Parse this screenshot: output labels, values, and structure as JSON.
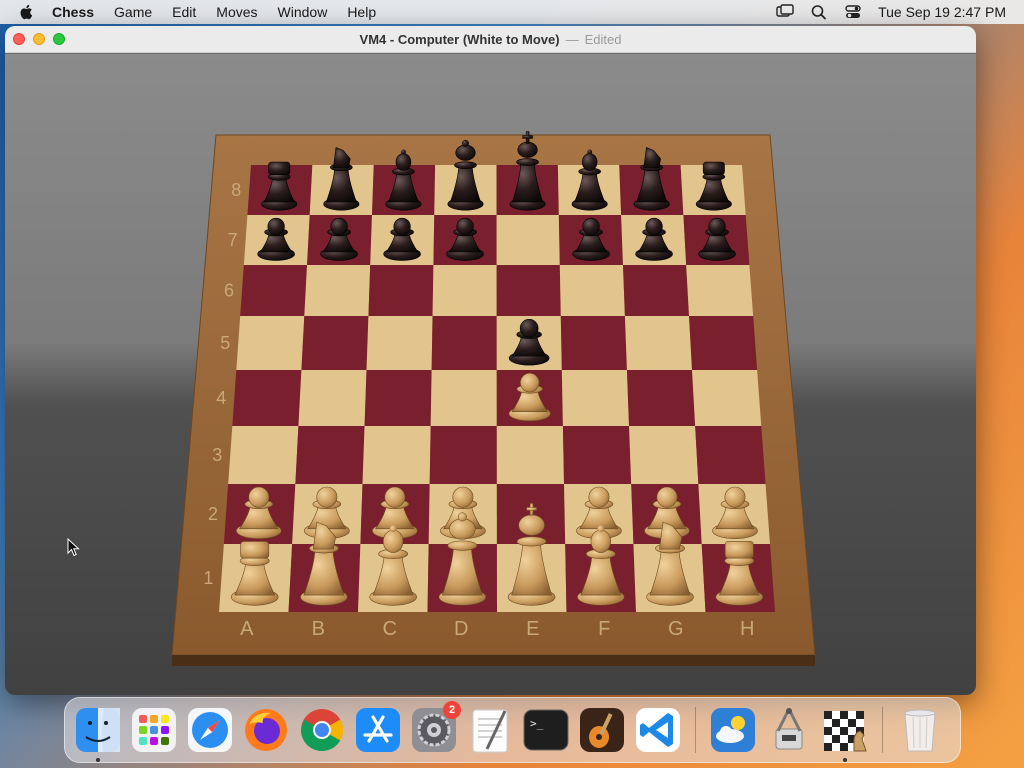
{
  "menubar": {
    "app_name": "Chess",
    "items": [
      "Game",
      "Edit",
      "Moves",
      "Window",
      "Help"
    ],
    "clock": "Tue Sep 19  2:47 PM",
    "icons": [
      "screen-mirroring-icon",
      "search-icon",
      "control-center-icon"
    ]
  },
  "window": {
    "title": "VM4 - Computer   (White to Move)",
    "separator": "—",
    "edited": "Edited"
  },
  "board": {
    "files": [
      "A",
      "B",
      "C",
      "D",
      "E",
      "F",
      "G",
      "H"
    ],
    "ranks": [
      "1",
      "2",
      "3",
      "4",
      "5",
      "6",
      "7",
      "8"
    ],
    "colors": {
      "light_square": "#e2c48d",
      "dark_square": "#7a1f2e",
      "frame": "#9b6a3a",
      "white_piece": "#c9a066",
      "black_piece": "#1e1414"
    },
    "pieces": [
      {
        "square": "a8",
        "color": "black",
        "type": "rook"
      },
      {
        "square": "b8",
        "color": "black",
        "type": "knight"
      },
      {
        "square": "c8",
        "color": "black",
        "type": "bishop"
      },
      {
        "square": "d8",
        "color": "black",
        "type": "queen"
      },
      {
        "square": "e8",
        "color": "black",
        "type": "king"
      },
      {
        "square": "f8",
        "color": "black",
        "type": "bishop"
      },
      {
        "square": "g8",
        "color": "black",
        "type": "knight"
      },
      {
        "square": "h8",
        "color": "black",
        "type": "rook"
      },
      {
        "square": "a7",
        "color": "black",
        "type": "pawn"
      },
      {
        "square": "b7",
        "color": "black",
        "type": "pawn"
      },
      {
        "square": "c7",
        "color": "black",
        "type": "pawn"
      },
      {
        "square": "d7",
        "color": "black",
        "type": "pawn"
      },
      {
        "square": "e5",
        "color": "black",
        "type": "pawn"
      },
      {
        "square": "f7",
        "color": "black",
        "type": "pawn"
      },
      {
        "square": "g7",
        "color": "black",
        "type": "pawn"
      },
      {
        "square": "h7",
        "color": "black",
        "type": "pawn"
      },
      {
        "square": "a2",
        "color": "white",
        "type": "pawn"
      },
      {
        "square": "b2",
        "color": "white",
        "type": "pawn"
      },
      {
        "square": "c2",
        "color": "white",
        "type": "pawn"
      },
      {
        "square": "d2",
        "color": "white",
        "type": "pawn"
      },
      {
        "square": "e4",
        "color": "white",
        "type": "pawn"
      },
      {
        "square": "f2",
        "color": "white",
        "type": "pawn"
      },
      {
        "square": "g2",
        "color": "white",
        "type": "pawn"
      },
      {
        "square": "h2",
        "color": "white",
        "type": "pawn"
      },
      {
        "square": "a1",
        "color": "white",
        "type": "rook"
      },
      {
        "square": "b1",
        "color": "white",
        "type": "knight"
      },
      {
        "square": "c1",
        "color": "white",
        "type": "bishop"
      },
      {
        "square": "d1",
        "color": "white",
        "type": "queen"
      },
      {
        "square": "e1",
        "color": "white",
        "type": "king"
      },
      {
        "square": "f1",
        "color": "white",
        "type": "bishop"
      },
      {
        "square": "g1",
        "color": "white",
        "type": "knight"
      },
      {
        "square": "h1",
        "color": "white",
        "type": "rook"
      }
    ]
  },
  "dock": {
    "items": [
      {
        "name": "finder",
        "icon": "finder-icon",
        "running": true
      },
      {
        "name": "launchpad",
        "icon": "launchpad-icon",
        "running": false
      },
      {
        "name": "safari",
        "icon": "safari-icon",
        "running": false
      },
      {
        "name": "firefox",
        "icon": "firefox-icon",
        "running": false
      },
      {
        "name": "chrome",
        "icon": "chrome-icon",
        "running": false
      },
      {
        "name": "app-store",
        "icon": "app-store-icon",
        "running": false
      },
      {
        "name": "system-settings",
        "icon": "system-settings-icon",
        "running": false,
        "badge": "2"
      },
      {
        "name": "textedit",
        "icon": "textedit-icon",
        "running": false
      },
      {
        "name": "terminal",
        "icon": "terminal-icon",
        "running": false
      },
      {
        "name": "garageband",
        "icon": "garageband-icon",
        "running": false
      },
      {
        "name": "vscode",
        "icon": "vscode-icon",
        "running": false
      },
      {
        "name": "weather",
        "icon": "weather-icon",
        "running": false
      },
      {
        "name": "archive-utility",
        "icon": "archive-utility-icon",
        "running": false
      },
      {
        "name": "chess",
        "icon": "chess-icon",
        "running": true
      },
      {
        "name": "trash",
        "icon": "trash-icon",
        "running": false
      }
    ],
    "terminal_prompt": ">_"
  }
}
